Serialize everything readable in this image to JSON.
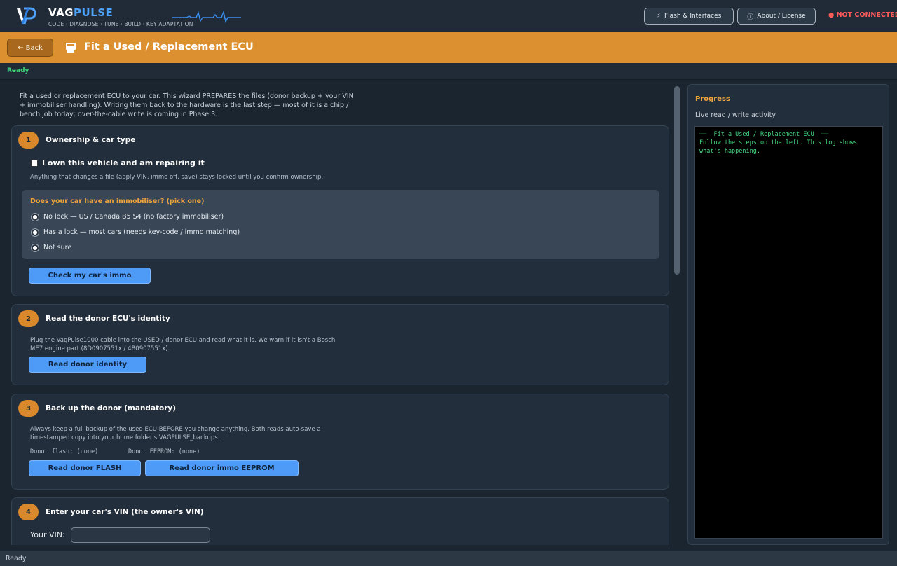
{
  "header": {
    "brand_prefix": "VAG",
    "brand_accent": "PULSE",
    "tagline": "CODE · DIAGNOSE · TUNE · BUILD · KEY ADAPTATION",
    "flash_button": "Flash & Interfaces",
    "about_button": "About / License",
    "connection_status": "● NOT CONNECTED"
  },
  "titlebar": {
    "back_label": "← Back",
    "title": "Fit a Used / Replacement ECU"
  },
  "status_top": "Ready",
  "intro": "Fit a used or replacement ECU to your car. This wizard PREPARES the files (donor backup + your VIN + immobiliser handling). Writing them back to the hardware is the last step — most of it is a chip / bench job today; over-the-cable write is coming in Phase 3.",
  "steps": [
    {
      "number": "1",
      "title": "Ownership & car type",
      "own_label": "I own this vehicle and am repairing it",
      "own_note": "Anything that changes a file (apply VIN, immo off, save) stays locked until you confirm ownership.",
      "immo_question": "Does your car have an immobiliser?  (pick one)",
      "options": [
        "No lock  —  US / Canada B5 S4 (no factory immobiliser)",
        "Has a lock  —  most cars (needs key-code / immo matching)",
        "Not sure"
      ],
      "button": "Check my car's immo"
    },
    {
      "number": "2",
      "title": "Read the donor ECU's identity",
      "note": "Plug the VagPulse1000 cable into the USED / donor ECU and read what it is. We warn if it isn't a Bosch ME7 engine part (8D0907551x / 4B0907551x).",
      "button": "Read donor identity"
    },
    {
      "number": "3",
      "title": "Back up the donor  (mandatory)",
      "note": "Always keep a full backup of the used ECU BEFORE you change anything. Both reads auto-save a timestamped copy into your home folder's VAGPULSE_backups.",
      "flash_status": "Donor flash: (none)",
      "eeprom_status": "Donor EEPROM: (none)",
      "button_flash": "Read donor FLASH",
      "button_eeprom": "Read donor immo EEPROM"
    },
    {
      "number": "4",
      "title": "Enter your car's VIN (the owner's VIN)",
      "vin_label": "Your VIN:",
      "vin_value": ""
    }
  ],
  "progress": {
    "title": "Progress",
    "subtitle": "Live read / write activity",
    "log": [
      "──  Fit a Used / Replacement ECU  ──",
      "Follow the steps on the left. This log shows what's happening."
    ]
  },
  "status_bottom": "Ready",
  "colors": {
    "accent_orange": "#dd902f",
    "button_blue": "#4e9bf7",
    "status_red": "#ff5a5a",
    "ready_green": "#3fd279",
    "log_green": "#45d97f"
  }
}
